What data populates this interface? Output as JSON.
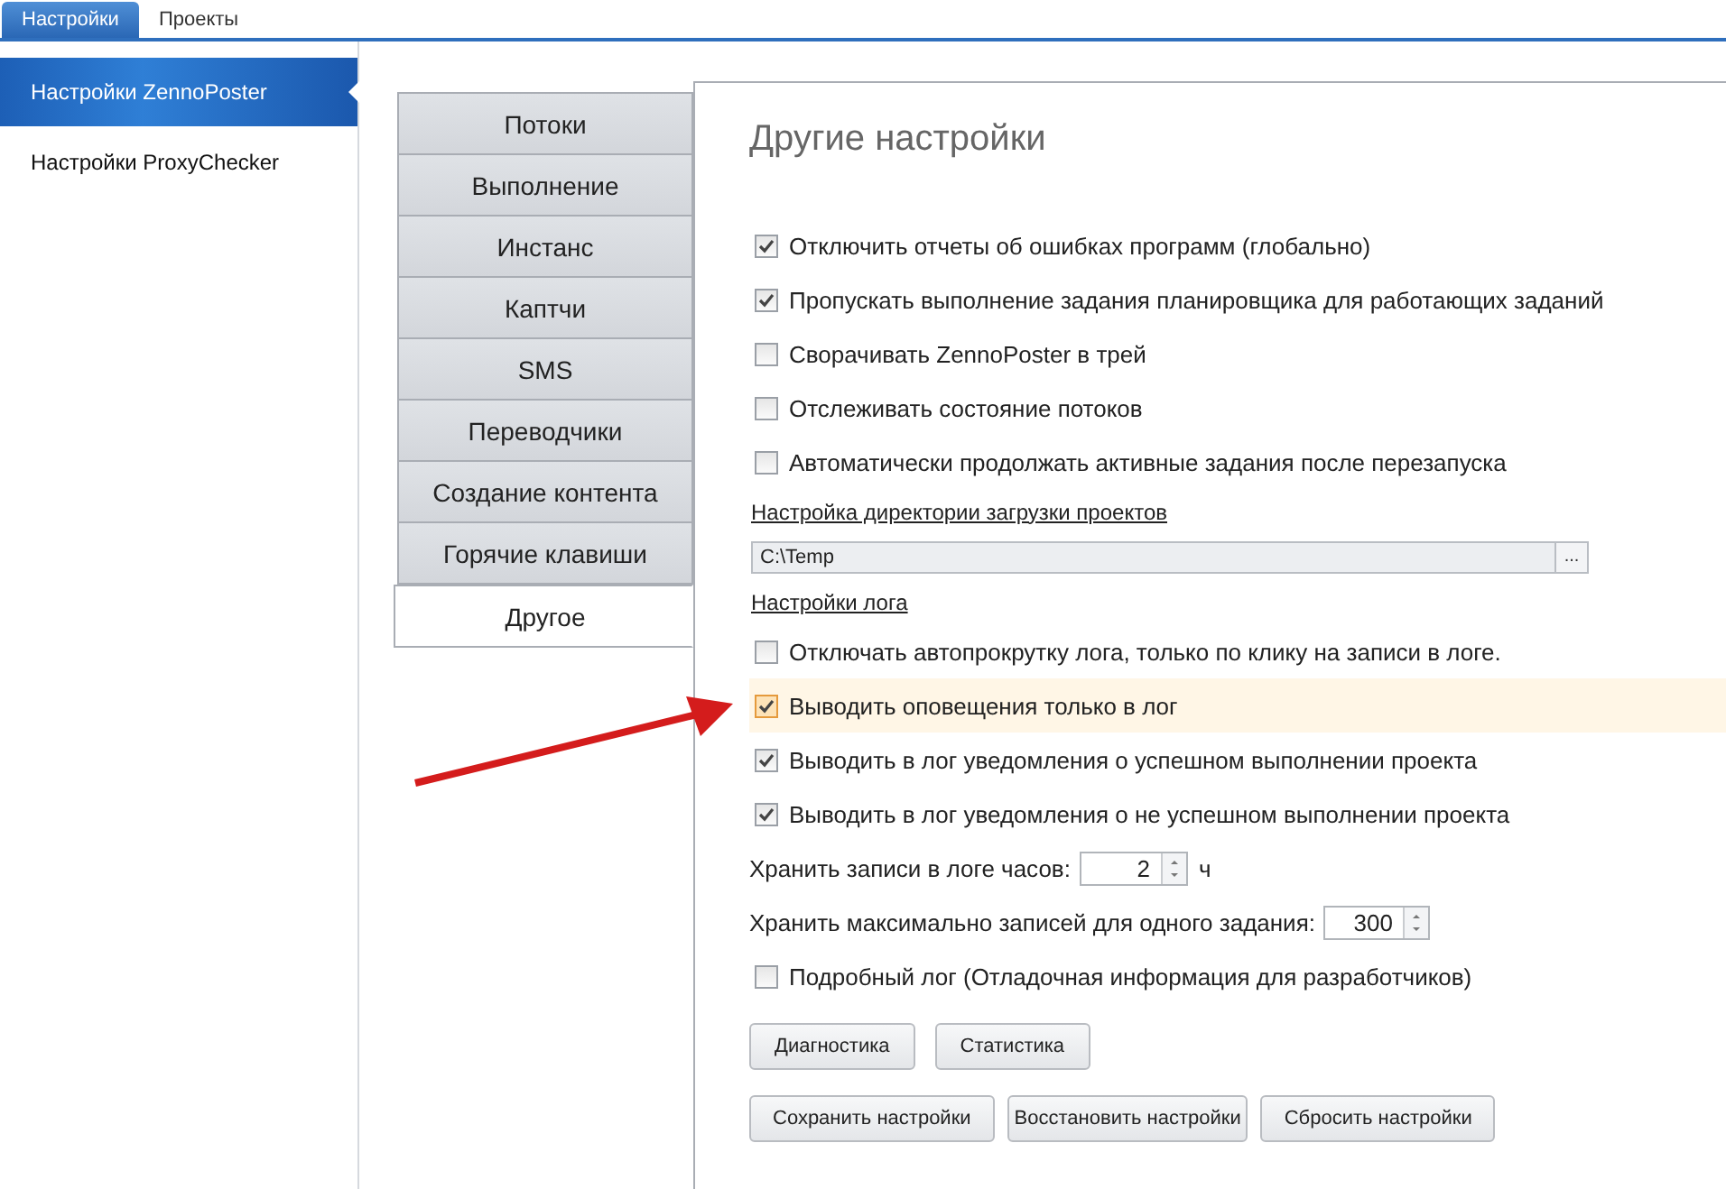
{
  "top_tabs": [
    {
      "label": "Настройки",
      "selected": true
    },
    {
      "label": "Проекты",
      "selected": false
    }
  ],
  "sidebar": {
    "items": [
      {
        "label": "Настройки ZennoPoster",
        "selected": true
      },
      {
        "label": "Настройки ProxyChecker",
        "selected": false
      }
    ]
  },
  "section_tabs": [
    {
      "label": "Потоки",
      "selected": false
    },
    {
      "label": "Выполнение",
      "selected": false
    },
    {
      "label": "Инстанс",
      "selected": false
    },
    {
      "label": "Каптчи",
      "selected": false
    },
    {
      "label": "SMS",
      "selected": false
    },
    {
      "label": "Переводчики",
      "selected": false
    },
    {
      "label": "Создание контента",
      "selected": false
    },
    {
      "label": "Горячие клавиши",
      "selected": false
    },
    {
      "label": "Другое",
      "selected": true
    }
  ],
  "panel": {
    "title": "Другие настройки",
    "items": [
      {
        "kind": "checkbox",
        "label": "Отключить отчеты об ошибках программ (глобально)",
        "checked": true,
        "focused": false
      },
      {
        "kind": "checkbox",
        "label": "Пропускать выполнение задания планировщика для работающих заданий",
        "checked": true,
        "focused": false
      },
      {
        "kind": "checkbox",
        "label": "Сворачивать ZennoPoster в трей",
        "checked": false,
        "focused": false
      },
      {
        "kind": "checkbox",
        "label": "Отслеживать состояние потоков",
        "checked": false,
        "focused": false
      },
      {
        "kind": "checkbox",
        "label": "Автоматически продолжать активные задания после перезапуска",
        "checked": false,
        "focused": false
      },
      {
        "kind": "link",
        "text": "Настройка директории загрузки проектов"
      },
      {
        "kind": "path",
        "value": "C:\\Temp",
        "button": "..."
      },
      {
        "kind": "link",
        "text": "Настройки лога"
      },
      {
        "kind": "checkbox",
        "label": "Отключать автопрокрутку лога, только по клику на записи в логе.",
        "checked": false,
        "focused": false
      },
      {
        "kind": "checkbox",
        "label": "Выводить оповещения только в лог",
        "checked": true,
        "focused": true
      },
      {
        "kind": "checkbox",
        "label": "Выводить в лог уведомления о успешном выполнении проекта",
        "checked": true,
        "focused": false
      },
      {
        "kind": "checkbox",
        "label": "Выводить в лог уведомления о не успешном выполнении проекта",
        "checked": true,
        "focused": false
      },
      {
        "kind": "spin",
        "label": "Хранить записи в логе часов:",
        "value": "2",
        "unit": "ч"
      },
      {
        "kind": "spin",
        "label": "Хранить максимально записей для одного задания:",
        "value": "300"
      },
      {
        "kind": "checkbox",
        "label": "Подробный лог (Отладочная информация для разработчиков)",
        "checked": false,
        "focused": false
      }
    ],
    "button_rows": [
      [
        "Диагностика",
        "Статистика"
      ],
      [
        "Сохранить настройки",
        "Восстановить настройки",
        "Сбросить настройки"
      ]
    ]
  }
}
